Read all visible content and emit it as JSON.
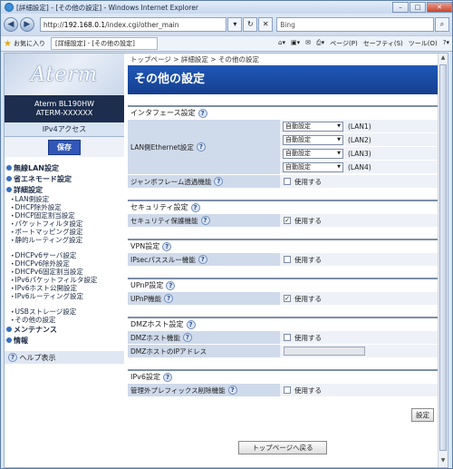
{
  "window": {
    "title": "[詳細設定] - [その他の設定] - Windows Internet Explorer"
  },
  "browser": {
    "url_prefix": "http://",
    "url_host": "192.168.0.1",
    "url_path": "/index.cgi/other_main",
    "search_placeholder": "Bing",
    "favorites_label": "お気に入り",
    "tab_label": "[詳細設定] - [その他の設定]",
    "tools": [
      "ページ(P)",
      "セーフティ(S)",
      "ツール(O)"
    ]
  },
  "sidebar": {
    "logo": "Aterm",
    "model_line1": "Aterm BL190HW",
    "model_line2": "ATERM-XXXXXX",
    "access": "IPv4アクセス",
    "save": "保存",
    "menu": [
      {
        "label": "無線LAN設定"
      },
      {
        "label": "省エネモード設定"
      },
      {
        "label": "詳細設定"
      }
    ],
    "subs_a": [
      "LAN側設定",
      "DHCP除外設定",
      "DHCP固定割当設定",
      "パケットフィルタ設定",
      "ポートマッピング設定",
      "静的ルーティング設定"
    ],
    "subs_b": [
      "DHCPv6サーバ設定",
      "DHCPv6除外設定",
      "DHCPv6固定割当設定",
      "IPv6パケットフィルタ設定",
      "IPv6ホスト公開設定",
      "IPv6ルーティング設定"
    ],
    "subs_c": [
      "USBストレージ設定",
      "その他の設定"
    ],
    "menu2": [
      {
        "label": "メンテナンス"
      },
      {
        "label": "情報"
      }
    ],
    "help": "ヘルプ表示"
  },
  "main": {
    "breadcrumb": "トップページ > 詳細設定 > その他の設定",
    "title": "その他の設定",
    "interface": {
      "head": "インタフェース設定",
      "lan_label": "LAN側Ethernet設定",
      "lans": [
        {
          "value": "自動設定",
          "port": "(LAN1)"
        },
        {
          "value": "自動設定",
          "port": "(LAN2)"
        },
        {
          "value": "自動設定",
          "port": "(LAN3)"
        },
        {
          "value": "自動設定",
          "port": "(LAN4)"
        }
      ],
      "jumbo_label": "ジャンボフレーム透過機能",
      "jumbo_check": "使用する"
    },
    "security": {
      "head": "セキュリティ設定",
      "label": "セキュリティ保護機能",
      "check": "使用する"
    },
    "vpn": {
      "head": "VPN設定",
      "label": "IPsecパススルー機能",
      "check": "使用する"
    },
    "upnp": {
      "head": "UPnP設定",
      "label": "UPnP機能",
      "check": "使用する"
    },
    "dmz": {
      "head": "DMZホスト設定",
      "label": "DMZホスト機能",
      "check": "使用する",
      "ip_label": "DMZホストのIPアドレス"
    },
    "ipv6": {
      "head": "IPv6設定",
      "label": "管理外プレフィックス削除機能",
      "check": "使用する"
    },
    "apply": "設定",
    "back": "トップページへ戻る"
  }
}
